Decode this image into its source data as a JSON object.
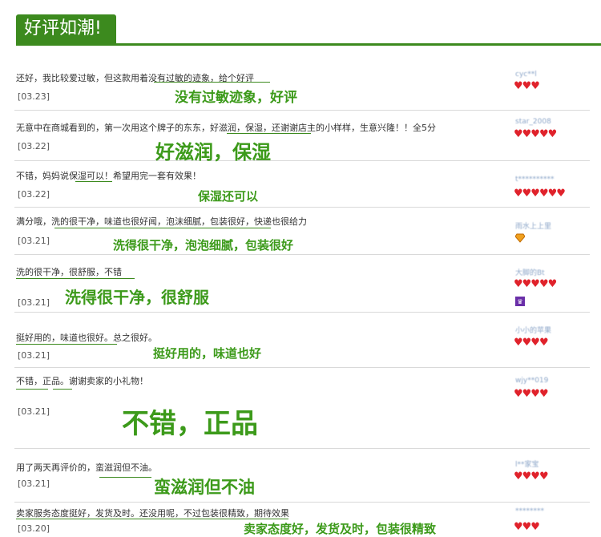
{
  "page_title": "好评如潮!",
  "reviews": [
    {
      "text": "还好，我比较爱过敏，但这款用着没有过敏的迹象，给个好评",
      "date": "[03.23]",
      "caption": "没有过敏迹象，好评",
      "user": "cyc**l",
      "hearts": "♥♥♥"
    },
    {
      "text": "无意中在商城看到的，第一次用这个牌子的东东，好滋润，保湿，还谢谢店主的小样样，生意兴隆！！全5分",
      "date": "[03.22]",
      "caption": "好滋润，保湿",
      "user": "star_2008",
      "hearts": "♥♥♥♥♥"
    },
    {
      "text": "不错，妈妈说保湿可以！希望用完一套有效果！",
      "date": "[03.22]",
      "caption": "保湿还可以",
      "user": "t**********",
      "hearts": "♥♥♥♥♥♥"
    },
    {
      "text": "满分哦，洗的很干净，味道也很好闻，泡沫细腻，包装很好，快递也很给力",
      "date": "[03.21]",
      "caption": "洗得很干净，泡泡细腻，包装很好",
      "user": "雨水上上里",
      "hearts": ""
    },
    {
      "text": "洗的很干净，很舒服，不错",
      "date": "[03.21]",
      "caption": "洗得很干净，很舒服",
      "user": "大脚的Bt",
      "hearts": "♥♥♥♥♥"
    },
    {
      "text": "挺好用的，味道也很好。总之很好。",
      "date": "[03.21]",
      "caption": "挺好用的，味道也好",
      "user": "小小的苹果",
      "hearts": "♥♥♥♥"
    },
    {
      "text": "不错，正品。谢谢卖家的小礼物！",
      "date": "[03.21]",
      "caption": "不错，正品",
      "user": "wjy**019",
      "hearts": "♥♥♥♥"
    },
    {
      "text": "用了两天再评价的，蛮滋润但不油。",
      "date": "[03.21]",
      "caption": "蛮滋润但不油",
      "user": "l**家宝",
      "hearts": "♥♥♥♥"
    },
    {
      "text": "卖家服务态度挺好，发货及时。还没用呢，不过包装很精致，期待效果",
      "date": "[03.20]",
      "caption": "卖家态度好，发货及时，包装很精致",
      "user": "********",
      "hearts": "♥♥♥"
    }
  ]
}
